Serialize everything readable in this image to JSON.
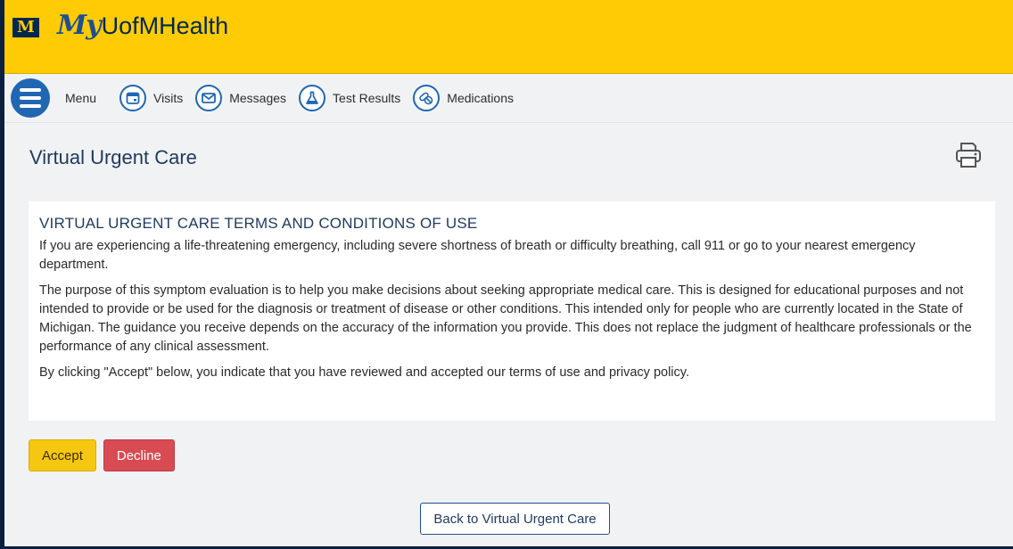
{
  "header": {
    "logo_letter": "M",
    "brand_my": "My",
    "brand_rest": "UofMHealth"
  },
  "nav": {
    "menu_label": "Menu",
    "items": [
      {
        "label": "Visits",
        "icon": "calendar-icon"
      },
      {
        "label": "Messages",
        "icon": "envelope-icon"
      },
      {
        "label": "Test Results",
        "icon": "flask-icon"
      },
      {
        "label": "Medications",
        "icon": "pills-icon"
      }
    ]
  },
  "page": {
    "title": "Virtual Urgent Care",
    "print_icon": "printer-icon"
  },
  "terms": {
    "heading": "VIRTUAL URGENT CARE TERMS AND CONDITIONS OF USE",
    "paragraphs": [
      "If you are experiencing a life-threatening emergency, including severe shortness of breath or difficulty breathing, call 911 or go to your nearest emergency department.",
      "The purpose of this symptom evaluation is to help you make decisions about seeking appropriate medical care. This is designed for educational purposes and not intended to provide or be used for the diagnosis or treatment of disease or other conditions. This intended only for people who are currently located in the State of Michigan. The guidance you receive depends on the accuracy of the information you provide. This does not replace the judgment of healthcare professionals or the performance of any clinical assessment.",
      "By clicking \"Accept\" below, you indicate that you have reviewed and accepted our terms of use and privacy policy."
    ]
  },
  "actions": {
    "accept_label": "Accept",
    "decline_label": "Decline",
    "back_label": "Back to Virtual Urgent Care"
  },
  "colors": {
    "header_bg": "#ffcb05",
    "brand_navy": "#00274c",
    "accent_blue": "#1f67b3",
    "accept": "#f6c710",
    "decline": "#d84b53"
  }
}
